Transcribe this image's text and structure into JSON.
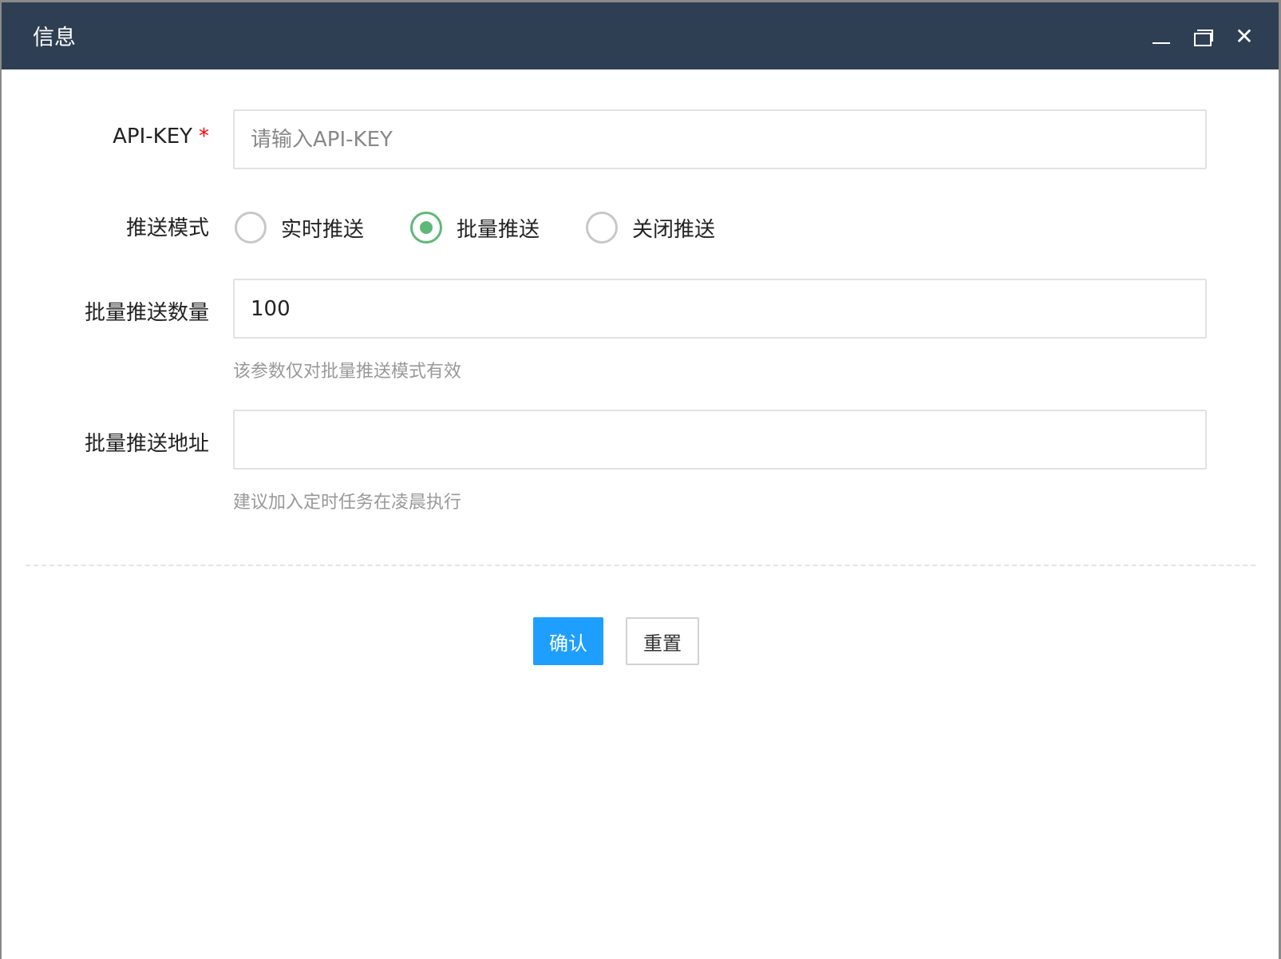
{
  "window": {
    "title": "信息",
    "minimize_icon": "minimize-icon",
    "maximize_icon": "restore-icon",
    "close_icon": "close-icon",
    "close_glyph": "✕"
  },
  "form": {
    "api_key": {
      "label": "API-KEY",
      "required": "*",
      "placeholder": "请输入API-KEY",
      "value": ""
    },
    "push_mode": {
      "label": "推送模式",
      "options": [
        {
          "label": "实时推送",
          "checked": false
        },
        {
          "label": "批量推送",
          "checked": true
        },
        {
          "label": "关闭推送",
          "checked": false
        }
      ]
    },
    "batch_count": {
      "label": "批量推送数量",
      "value": "100",
      "hint": "该参数仅对批量推送模式有效"
    },
    "batch_url": {
      "label": "批量推送地址",
      "value": "",
      "hint": "建议加入定时任务在凌晨执行"
    }
  },
  "buttons": {
    "confirm": "确认",
    "reset": "重置"
  },
  "colors": {
    "titlebar": "#2f3f53",
    "primary": "#1e9fff",
    "radio_checked": "#5fb878"
  }
}
